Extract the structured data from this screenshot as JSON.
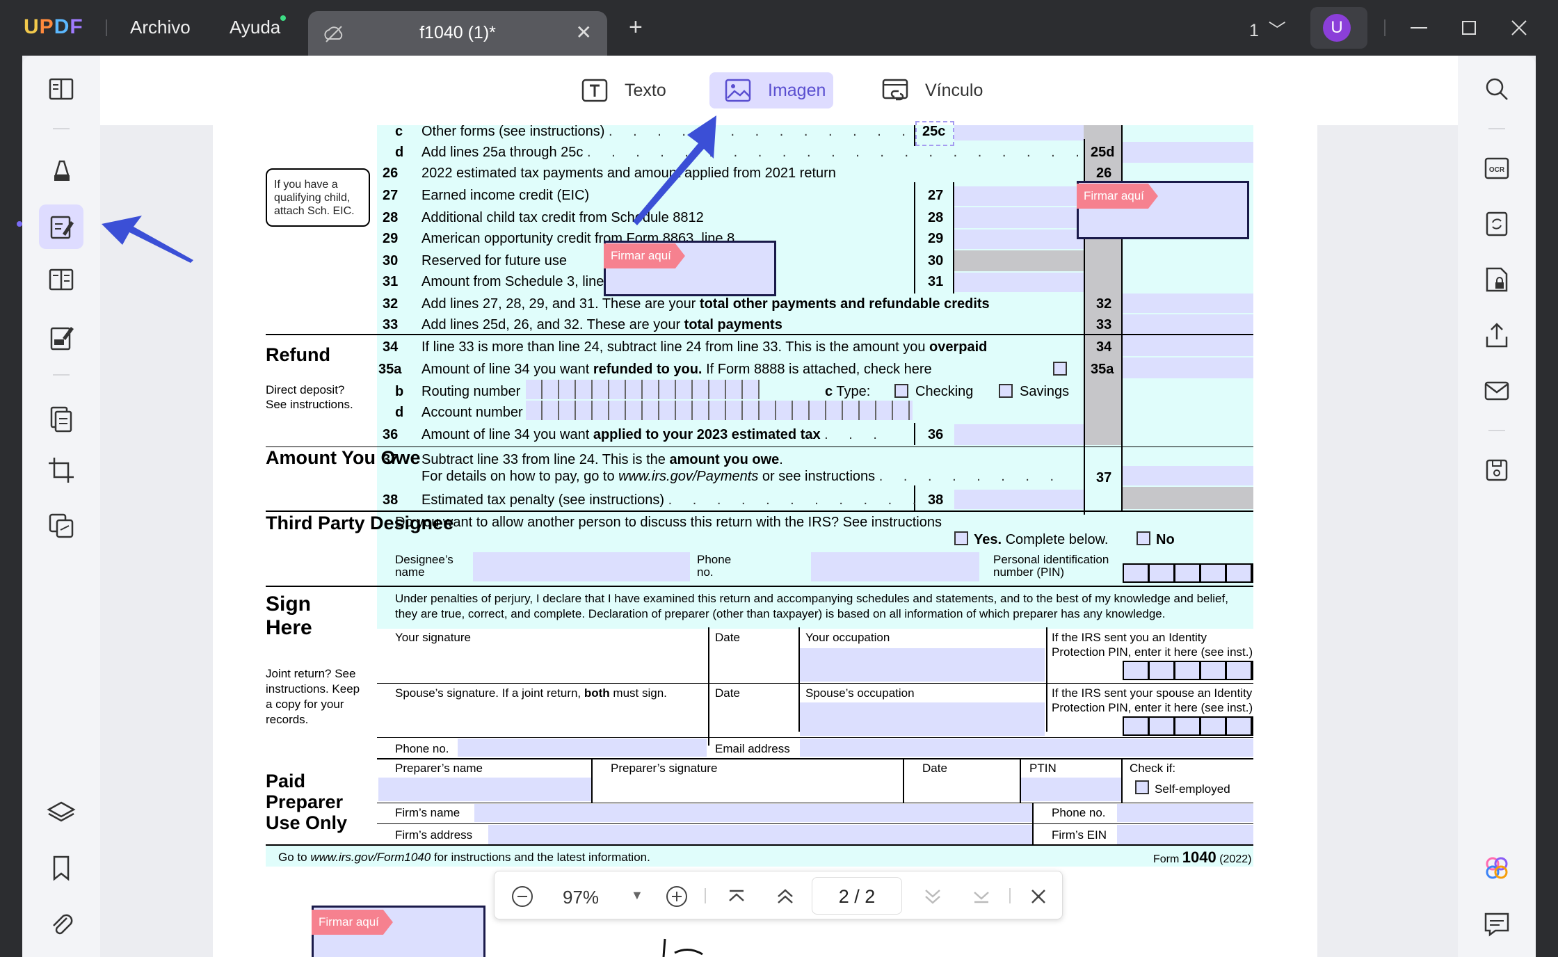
{
  "app": {
    "logo": "UPDF",
    "menu": [
      "Archivo",
      "Ayuda"
    ],
    "tab_title": "f1040 (1)*",
    "page_indicator": "1",
    "user_initial": "U"
  },
  "toolbar": {
    "text_label": "Texto",
    "image_label": "Imagen",
    "link_label": "Vínculo",
    "active": "Imagen"
  },
  "sign_tags": [
    "Firmar aquí",
    "Firmar aquí",
    "Firmar aquí"
  ],
  "callout": "If you have a qualifying child, attach Sch. EIC.",
  "form": {
    "lines": [
      {
        "num": "c",
        "text": "Other forms (see instructions)",
        "box": "25c"
      },
      {
        "num": "d",
        "text": "Add lines 25a through 25c",
        "box": "25d"
      },
      {
        "num": "26",
        "text": "2022 estimated tax payments and amount applied from 2021 return",
        "box": "26"
      },
      {
        "num": "27",
        "text": "Earned income credit (EIC)",
        "box": "27"
      },
      {
        "num": "28",
        "text": "Additional child tax credit from Schedule 8812",
        "box": "28"
      },
      {
        "num": "29",
        "text": "American opportunity credit from Form 8863, line 8",
        "box": "29"
      },
      {
        "num": "30",
        "text": "Reserved for future use",
        "box": "30"
      },
      {
        "num": "31",
        "text": "Amount from Schedule 3, line 15",
        "box": "31"
      },
      {
        "num": "32",
        "text": "Add lines 27, 28, 29, and 31. These are your",
        "bold": "total other payments and refundable credits",
        "box": "32"
      },
      {
        "num": "33",
        "text": "Add lines 25d, 26, and 32. These are your",
        "bold": "total payments",
        "box": "33"
      },
      {
        "num": "34",
        "text": "If line 33 is more than line 24, subtract line 24 from line 33. This is the amount you",
        "bold": "overpaid",
        "box": "34"
      },
      {
        "num": "35a",
        "text": "Amount of line 34 you want",
        "bold": "refunded to you.",
        "after": "If Form 8888 is attached, check here",
        "box": "35a"
      },
      {
        "num": "b",
        "text": "Routing number"
      },
      {
        "num": "d",
        "text": "Account number"
      },
      {
        "num": "36",
        "text": "Amount of line 34 you want",
        "bold": "applied to your 2023 estimated tax",
        "box": "36"
      },
      {
        "num": "37",
        "text": "Subtract line 33 from line 24. This is the",
        "bold": "amount you owe",
        "after": ".",
        "box": "37"
      },
      {
        "num": "38",
        "text": "Estimated tax penalty (see instructions)",
        "box": "38"
      }
    ],
    "line37_detail_pre": "For details on how to pay, go to",
    "line37_detail_url": "www.irs.gov/Payments",
    "line37_detail_post": "or see instructions",
    "type_label": "c Type:",
    "type_c": "c",
    "type_word": "Type:",
    "checking": "Checking",
    "savings": "Savings",
    "refund": "Refund",
    "direct_deposit": "Direct deposit? See instructions.",
    "amount_owe": "Amount You Owe",
    "third_party": "Third Party Designee",
    "third_party_q": "Do you want to allow another person to discuss this return with the IRS? See instructions",
    "yes": "Yes.",
    "yes_after": "Complete below.",
    "no": "No",
    "designee_name": "Designee’s name",
    "phone_no_short": "Phone no.",
    "pin": "Personal identification number (PIN)",
    "sign_here": "Sign Here",
    "perjury": "Under penalties of perjury, I declare that I have examined this return and accompanying schedules and statements, and to the best of my knowledge and belief, they are true, correct, and complete. Declaration of preparer (other than taxpayer) is based on all information of which preparer has any knowledge.",
    "your_signature": "Your signature",
    "date": "Date",
    "your_occupation": "Your occupation",
    "ip_pin": "If the IRS sent you an Identity Protection PIN, enter it here (see inst.)",
    "joint": "Joint return? See instructions. Keep a copy for your records.",
    "spouse_sig_pre": "Spouse’s signature. If a joint return,",
    "spouse_sig_bold": "both",
    "spouse_sig_post": "must sign.",
    "spouse_occupation": "Spouse’s occupation",
    "spouse_pin": "If the IRS sent your spouse an Identity Protection PIN, enter it here (see inst.)",
    "phone_no": "Phone no.",
    "email": "Email address",
    "paid_preparer": "Paid Preparer Use Only",
    "preparer_name": "Preparer’s name",
    "preparer_sig": "Preparer’s signature",
    "ptin": "PTIN",
    "check_if": "Check if:",
    "self_employed": "Self-employed",
    "firm_name": "Firm’s name",
    "firm_address": "Firm’s address",
    "firm_ein": "Firm’s EIN",
    "footer_pre": "Go to",
    "footer_url": "www.irs.gov/Form1040",
    "footer_post": "for instructions and the latest information.",
    "form_label": "Form",
    "form_num": "1040",
    "form_year": "(2022)"
  },
  "zoom": {
    "value": "97%",
    "page": "2  /  2"
  },
  "colors": {
    "accent": "#7a6cf5",
    "field": "#dcdffe",
    "form_bg": "#e0fdfb",
    "sign_tag": "#f6818f",
    "arrow": "#3b4fd6"
  }
}
